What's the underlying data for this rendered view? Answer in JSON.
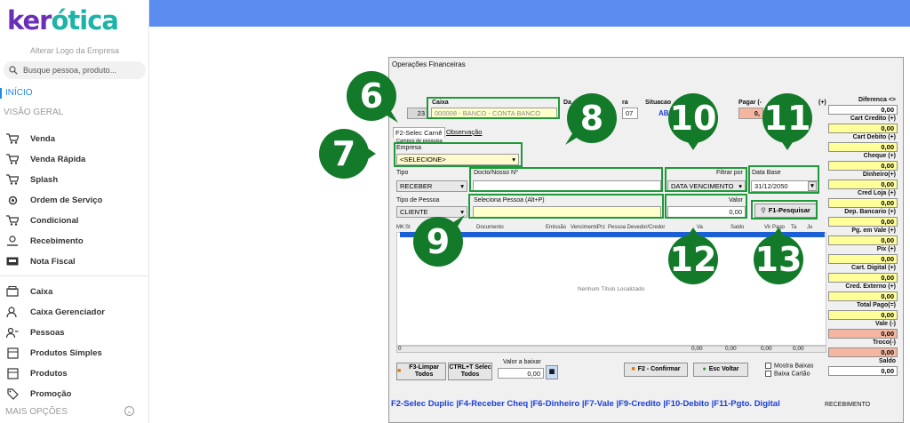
{
  "brand": {
    "part1": "ker",
    "part2": "ótica"
  },
  "sidebar": {
    "logo_hint": "Alterar Logo da Empresa",
    "search_placeholder": "Busque pessoa, produto...",
    "section_home": "INÍCIO",
    "section_overview": "VISÃO GERAL",
    "section_more": "MAIS OPÇÕES",
    "items": [
      {
        "label": "Venda",
        "icon": "cart-icon"
      },
      {
        "label": "Venda Rápida",
        "icon": "cart-fast-icon"
      },
      {
        "label": "Splash",
        "icon": "cart-icon"
      },
      {
        "label": "Ordem de Serviço",
        "icon": "wrench-icon"
      },
      {
        "label": "Condicional",
        "icon": "cart-icon"
      },
      {
        "label": "Recebimento",
        "icon": "money-hand-icon"
      },
      {
        "label": "Nota Fiscal",
        "icon": "nfe-icon"
      },
      {
        "label": "Caixa",
        "icon": "register-icon"
      },
      {
        "label": "Caixa Gerenciador",
        "icon": "cash-manager-icon"
      },
      {
        "label": "Pessoas",
        "icon": "people-icon"
      },
      {
        "label": "Produtos Simples",
        "icon": "box-icon"
      },
      {
        "label": "Produtos",
        "icon": "box-icon"
      },
      {
        "label": "Promoção",
        "icon": "tag-icon"
      }
    ]
  },
  "dialog": {
    "title": "Operações Financeiras",
    "caixa_label": "Caixa",
    "caixa_num": "23",
    "caixa_value": "000008 - BANCO - CONTA BANCO",
    "data_label": "Da",
    "ra_label": "ra",
    "situacao_label": "Situacao",
    "situacao_value": "AB",
    "ra_value": "07",
    "pagar_label": "Pagar (-",
    "pagar_value": "0,",
    "plus_label": "(+)",
    "tab_carne": "F2-Selec Carnê",
    "tab_obs": "Observação",
    "campos_label": "Campos de pesquisa",
    "empresa_label": "Empresa",
    "empresa_value": "<SELECIONE>",
    "tipo_label": "Tipo",
    "tipo_value": "RECEBER",
    "docto_label": "Docto/Nosso Nº",
    "filtrar_label": "Filtrar por",
    "filtrar_value": "DATA VENCIMENTO",
    "database_label": "Data Base",
    "database_value": "31/12/2050",
    "tipo_pessoa_label": "Tipo de Pessoa",
    "tipo_pessoa_value": "CLIENTE",
    "seleciona_pessoa_label": "Seleciona Pessoa (Alt+P)",
    "valor_label": "Valor",
    "valor_value": "0,00",
    "pesquisar_label": "F1-Pesquisar",
    "grid_cols": [
      "MK",
      "St",
      "Documento",
      "Emissão",
      "Vencimento",
      "Prz",
      "Pessoa Devedor/Credor",
      "Va",
      "Saldo",
      "Vlr Pago",
      "Ta",
      "Ju"
    ],
    "empty_msg": "Nenhum Título Localizado",
    "total_count": "0",
    "totals": [
      "0,00",
      "0,00",
      "0,00",
      "0,00"
    ],
    "btn_f3": "F3-Limpar Todos",
    "btn_ctrlt": "CTRL+T Selec Todos",
    "valor_baixar_label": "Valor a baixar",
    "valor_baixar_value": "0,00",
    "btn_confirmar": "F2 - Confirmar",
    "btn_esc": "Esc Voltar",
    "chk_mostra": "Mostra Baixas",
    "chk_cartao": "Baixa Cartão",
    "fkeys": "F2-Selec Duplic |F4-Receber Cheq |F6-Dinheiro |F7-Vale |F9-Credito |F10-Debito |F11-Pgto. Digital",
    "recebimento": "RECEBIMENTO"
  },
  "right_panel": [
    {
      "label": "Diferenca <>",
      "value": "0,00",
      "color": "#ffffff"
    },
    {
      "label": "Cart Credito (+)",
      "value": "0,00",
      "color": "#ffff99"
    },
    {
      "label": "Cart Debito (+)",
      "value": "0,00",
      "color": "#ffff99"
    },
    {
      "label": "Cheque (+)",
      "value": "0,00",
      "color": "#ffff99"
    },
    {
      "label": "Dinheiro(+)",
      "value": "0,00",
      "color": "#ffff99"
    },
    {
      "label": "Cred Loja (+)",
      "value": "0,00",
      "color": "#ffff99"
    },
    {
      "label": "Dep. Bancario (+)",
      "value": "0,00",
      "color": "#ffff99"
    },
    {
      "label": "Pg. em Vale (+)",
      "value": "0,00",
      "color": "#ffff99"
    },
    {
      "label": "Pix (+)",
      "value": "0,00",
      "color": "#ffff99"
    },
    {
      "label": "Cart. Digital (+)",
      "value": "0,00",
      "color": "#ffff99"
    },
    {
      "label": "Cred. Externo (+)",
      "value": "0,00",
      "color": "#ffff99"
    },
    {
      "label": "Total Pago(=)",
      "value": "0,00",
      "color": "#ffff99"
    },
    {
      "label": "Vale (-)",
      "value": "0,00",
      "color": "#f4b6a0"
    },
    {
      "label": "Troco(-)",
      "value": "0,00",
      "color": "#f4b6a0"
    },
    {
      "label": "Saldo",
      "value": "0,00",
      "color": "#ffffff"
    }
  ],
  "callouts": [
    "6",
    "7",
    "8",
    "9",
    "10",
    "11",
    "12",
    "13"
  ],
  "colors": {
    "callout": "#137a2a",
    "highlight": "#1f9a3a",
    "topbar": "#5b8def",
    "fkeys": "#1a3ed6"
  }
}
